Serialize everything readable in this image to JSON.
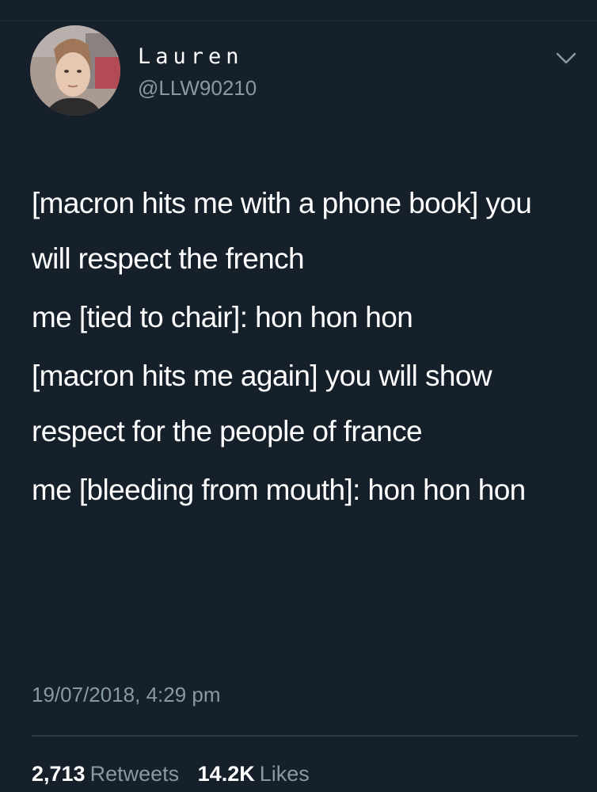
{
  "author": {
    "display_name": "Lauren",
    "handle": "@LLW90210"
  },
  "icons": {
    "avatar": "profile-photo",
    "menu": "chevron-down-icon"
  },
  "tweet": {
    "paragraphs": [
      "[macron hits me with a phone book] you will respect the french",
      "me [tied to chair]: hon hon hon",
      "[macron hits me again] you will show respect for the people of france",
      "me [bleeding from mouth]: hon hon hon"
    ],
    "timestamp": "19/07/2018, 4:29 pm"
  },
  "stats": {
    "retweets_count": "2,713",
    "retweets_label": "Retweets",
    "likes_count": "14.2K",
    "likes_label": "Likes"
  },
  "colors": {
    "background": "#16202b",
    "primary_text": "#ffffff",
    "secondary_text": "#8899a6",
    "divider": "#2c3a47"
  }
}
